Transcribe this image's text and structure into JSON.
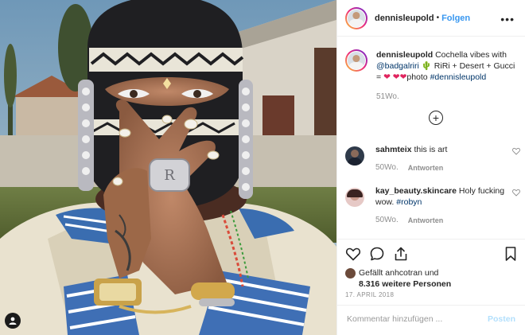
{
  "post": {
    "username": "dennisleupold",
    "separator": "•",
    "follow_label": "Folgen",
    "more_label": "•••"
  },
  "caption": {
    "username": "dennisleupold",
    "text_1": "Cochella vibes with",
    "mention": "@badgalriri",
    "cactus": "🌵",
    "text_2": "RiRi + Desert + Gucci =",
    "hearts": "❤ ❤❤",
    "text_3": "photo",
    "hashtag": "#dennisleupold",
    "time": "51Wo."
  },
  "load_more_label": "+",
  "comments": [
    {
      "username": "sahmteix",
      "text": "this is art",
      "time": "50Wo.",
      "reply_label": "Antworten"
    },
    {
      "username": "kay_beauty.skincare",
      "text": "Holy fucking wow.",
      "hashtag": "#robyn",
      "time": "50Wo.",
      "reply_label": "Antworten"
    }
  ],
  "likes": {
    "line_1": "Gefällt anhcotran und",
    "line_2": "8.316 weitere Personen"
  },
  "date": "17. APRIL 2018",
  "comment_field": {
    "placeholder": "Kommentar hinzufügen ...",
    "post_label": "Posten"
  },
  "colors": {
    "link": "#003569",
    "follow": "#3897f0",
    "muted": "#8e8e8e",
    "post_disabled": "#b2dffc"
  }
}
